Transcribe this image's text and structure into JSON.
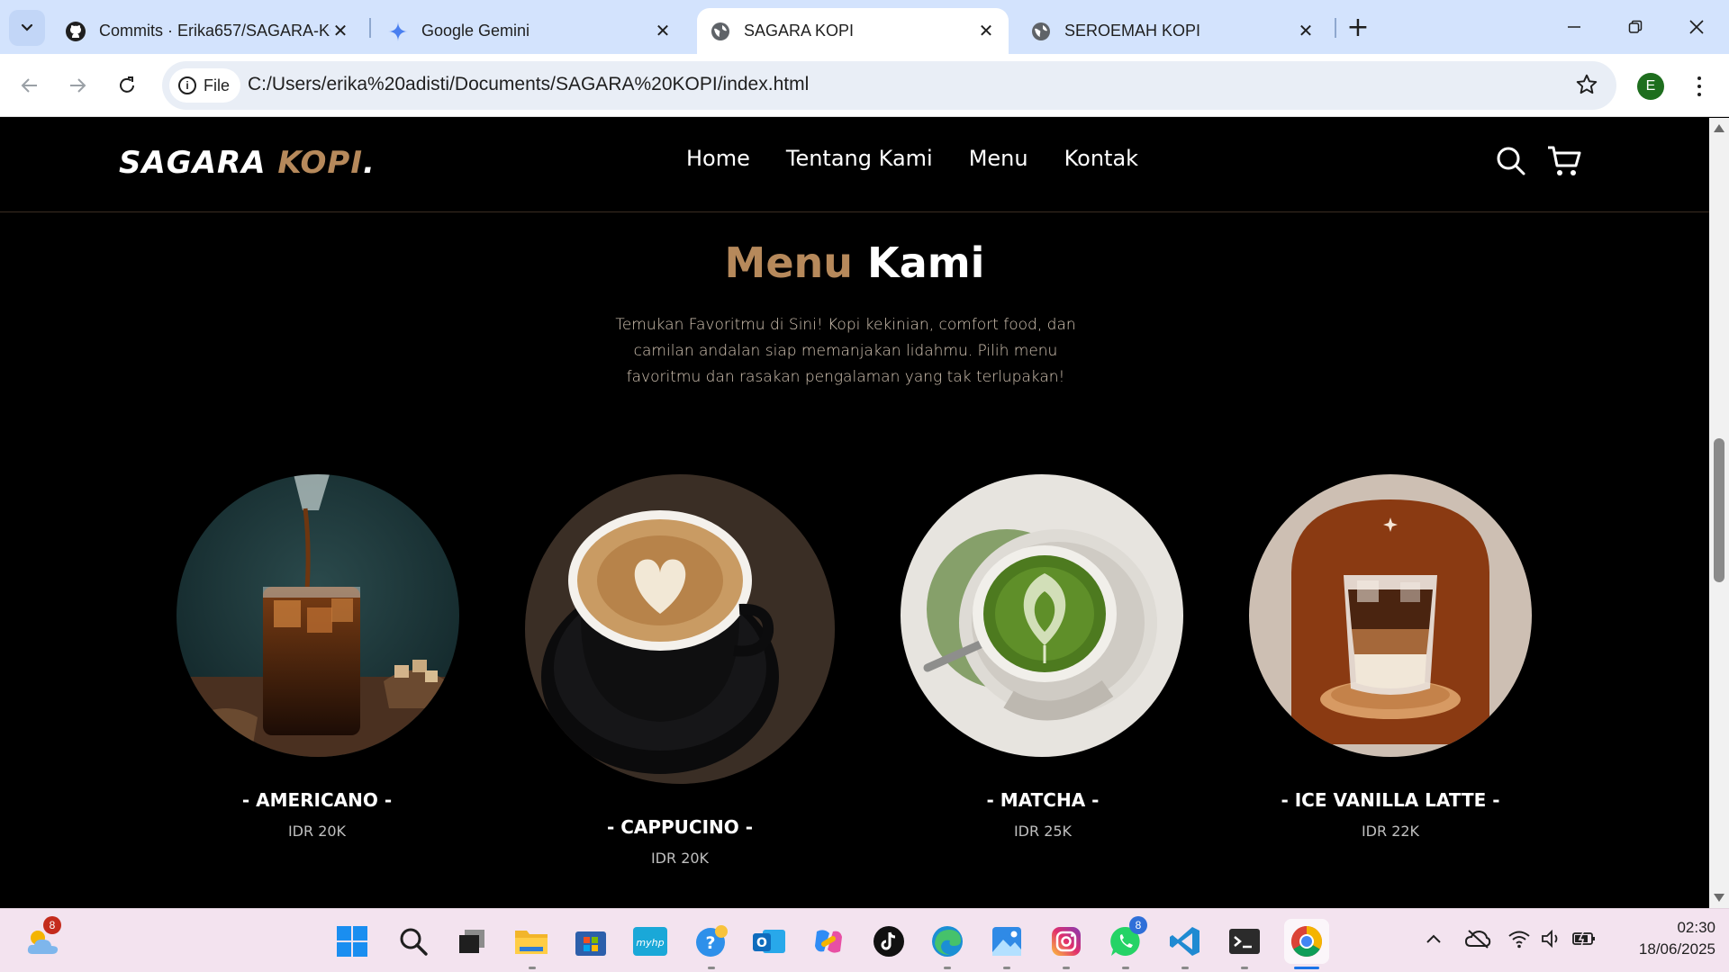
{
  "browser": {
    "tabs": [
      {
        "title": "Commits · Erika657/SAGARA-KOPI",
        "icon": "github-icon",
        "active": false
      },
      {
        "title": "Google Gemini",
        "icon": "gemini-icon",
        "active": false
      },
      {
        "title": "SAGARA KOPI",
        "icon": "globe-icon",
        "active": true
      },
      {
        "title": "SEROEMAH KOPI",
        "icon": "globe-icon",
        "active": false
      }
    ],
    "new_tab_label": "+",
    "chip_label": "File",
    "url": "C:/Users/erika%20adisti/Documents/SAGARA%20KOPI/index.html",
    "profile_initial": "E"
  },
  "site": {
    "logo_main": "SAGARA",
    "logo_accent": "KOPI",
    "logo_dot": ".",
    "nav": [
      "Home",
      "Tentang Kami",
      "Menu",
      "Kontak"
    ],
    "section_title_accent": "Menu",
    "section_title_main": "Kami",
    "section_desc": "Temukan Favoritmu di Sini! Kopi kekinian, comfort food, dan camilan andalan siap memanjakan lidahmu. Pilih menu favoritmu dan rasakan pengalaman yang tak terlupakan!",
    "menu_items": [
      {
        "name": "- AMERICANO -",
        "price": "IDR 20K"
      },
      {
        "name": "- CAPPUCINO -",
        "price": "IDR 20K"
      },
      {
        "name": "- MATCHA -",
        "price": "IDR 25K"
      },
      {
        "name": "- ICE VANILLA LATTE -",
        "price": "IDR 22K"
      }
    ]
  },
  "taskbar": {
    "weather_badge": "8",
    "whatsapp_badge": "8",
    "time": "02:30",
    "date": "18/06/2025"
  },
  "colors": {
    "accent": "#b6895b",
    "page_bg": "#000000",
    "tabbar_bg": "#d3e3fd"
  }
}
